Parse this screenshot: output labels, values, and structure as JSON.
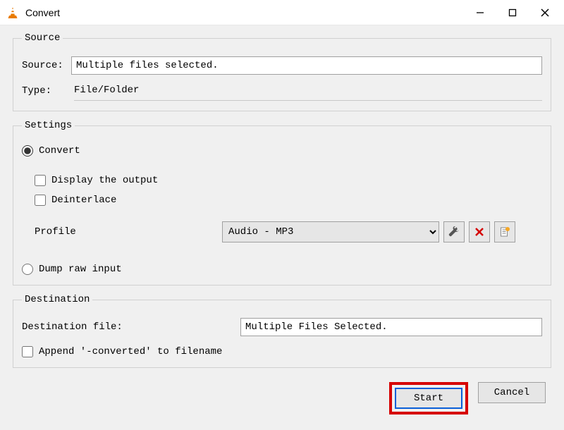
{
  "window": {
    "title": "Convert"
  },
  "source": {
    "legend": "Source",
    "source_label": "Source:",
    "source_value": "Multiple files selected.",
    "type_label": "Type:",
    "type_value": "File/Folder"
  },
  "settings": {
    "legend": "Settings",
    "convert_label": "Convert",
    "display_output_label": "Display the output",
    "deinterlace_label": "Deinterlace",
    "profile_label": "Profile",
    "profile_value": "Audio - MP3",
    "dump_raw_label": "Dump raw input"
  },
  "destination": {
    "legend": "Destination",
    "file_label": "Destination file:",
    "file_value": "Multiple Files Selected.",
    "append_label": "Append '-converted' to filename"
  },
  "buttons": {
    "start": "Start",
    "cancel": "Cancel"
  },
  "state": {
    "convert_checked": true,
    "display_output_checked": false,
    "deinterlace_checked": false,
    "dump_raw_checked": false,
    "append_checked": false
  }
}
